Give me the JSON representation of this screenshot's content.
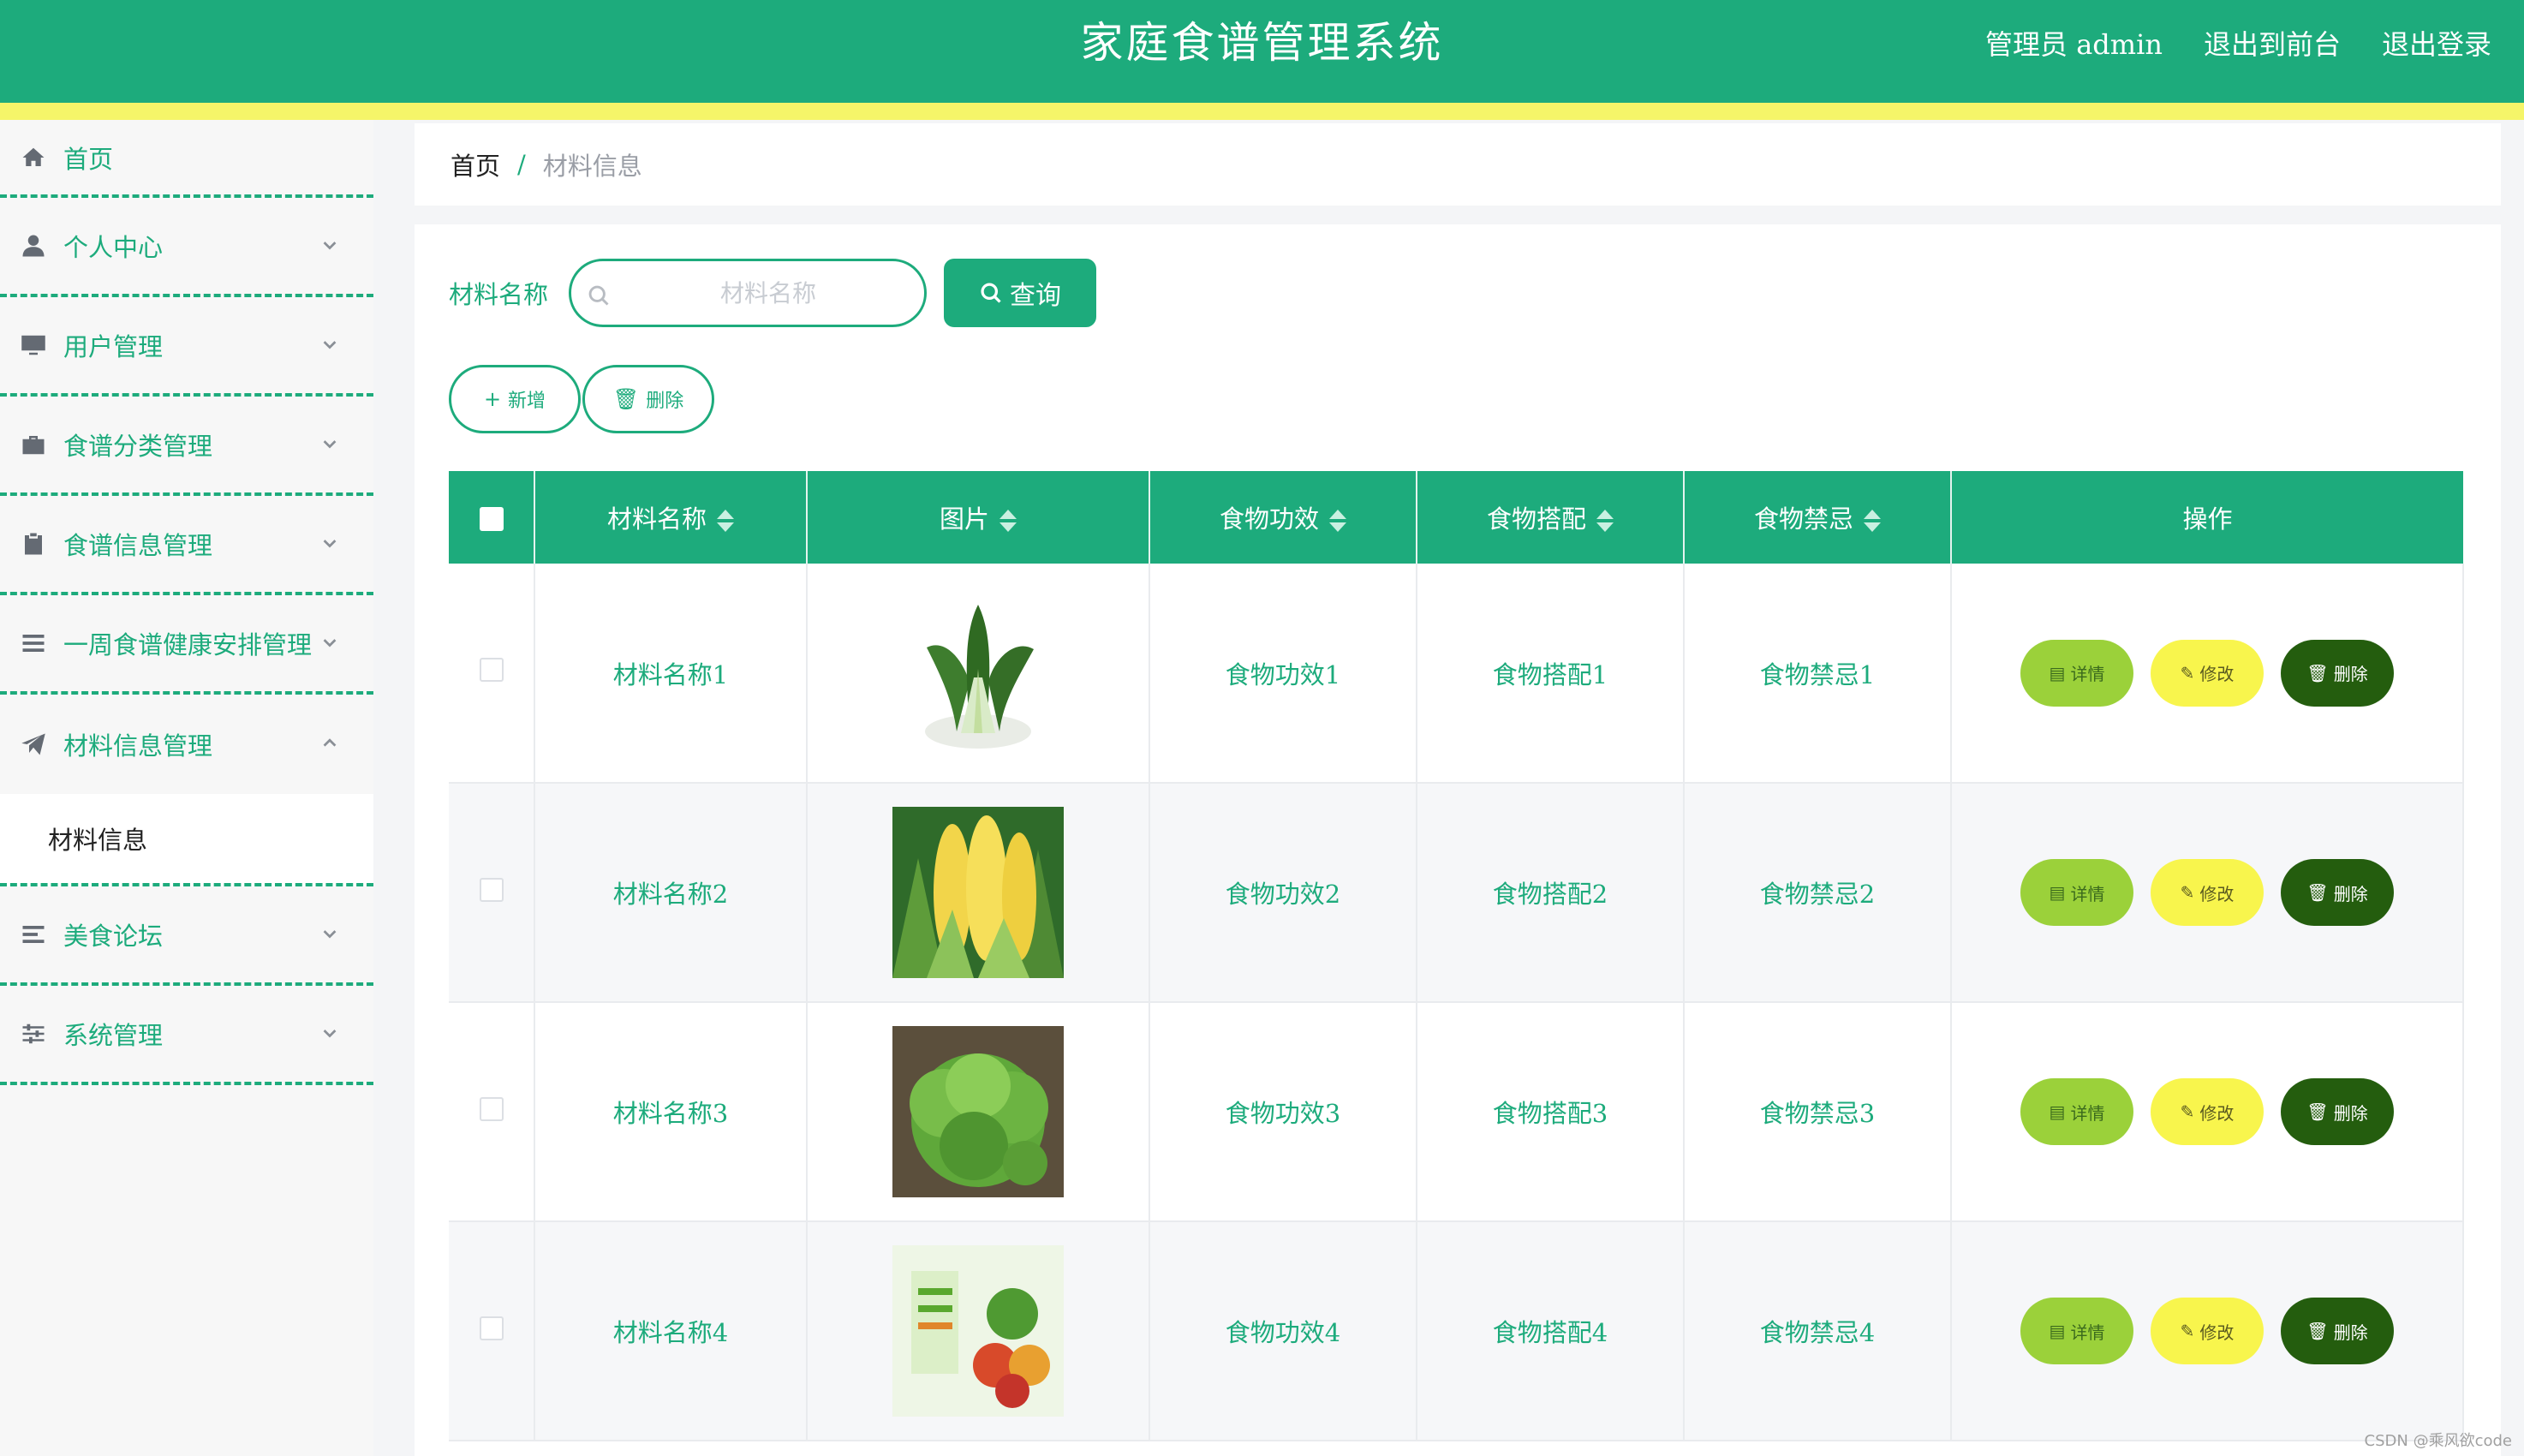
{
  "header": {
    "title": "家庭食谱管理系统",
    "admin_label": "管理员 admin",
    "front_link": "退出到前台",
    "logout_link": "退出登录"
  },
  "sidebar": {
    "items": [
      {
        "label": "首页",
        "icon": "home-icon",
        "chevron": false
      },
      {
        "label": "个人中心",
        "icon": "user-icon",
        "chevron": true
      },
      {
        "label": "用户管理",
        "icon": "monitor-icon",
        "chevron": true
      },
      {
        "label": "食谱分类管理",
        "icon": "briefcase-icon",
        "chevron": true
      },
      {
        "label": "食谱信息管理",
        "icon": "clipboard-icon",
        "chevron": true
      },
      {
        "label": "一周食谱健康安排管理",
        "icon": "list-icon",
        "chevron": true
      },
      {
        "label": "材料信息管理",
        "icon": "paper-plane-icon",
        "chevron": true,
        "open": true
      },
      {
        "label": "美食论坛",
        "icon": "menu-lines-icon",
        "chevron": true
      },
      {
        "label": "系统管理",
        "icon": "sliders-icon",
        "chevron": true
      }
    ],
    "sub_item": "材料信息"
  },
  "breadcrumb": {
    "home": "首页",
    "separator": "/",
    "current": "材料信息"
  },
  "search": {
    "label": "材料名称",
    "placeholder": "材料名称",
    "value": "",
    "button": "查询"
  },
  "actions": {
    "add": "新增",
    "delete": "删除"
  },
  "table": {
    "columns": [
      "材料名称",
      "图片",
      "食物功效",
      "食物搭配",
      "食物禁忌",
      "操作"
    ],
    "rows": [
      {
        "name": "材料名称1",
        "effect": "食物功效1",
        "pairing": "食物搭配1",
        "taboo": "食物禁忌1",
        "image": "bok-choy"
      },
      {
        "name": "材料名称2",
        "effect": "食物功效2",
        "pairing": "食物搭配2",
        "taboo": "食物禁忌2",
        "image": "corn"
      },
      {
        "name": "材料名称3",
        "effect": "食物功效3",
        "pairing": "食物搭配3",
        "taboo": "食物禁忌3",
        "image": "lettuce"
      },
      {
        "name": "材料名称4",
        "effect": "食物功效4",
        "pairing": "食物搭配4",
        "taboo": "食物禁忌4",
        "image": "fresh-veg-poster"
      }
    ],
    "op_labels": {
      "detail": "详情",
      "edit": "修改",
      "delete": "删除"
    }
  },
  "colors": {
    "primary": "#1dab7c",
    "accent_strip": "#f5f569",
    "detail": "#9bd13a",
    "edit": "#f8f54d",
    "delete": "#245d0e"
  },
  "watermark": "CSDN @乘风欲code"
}
